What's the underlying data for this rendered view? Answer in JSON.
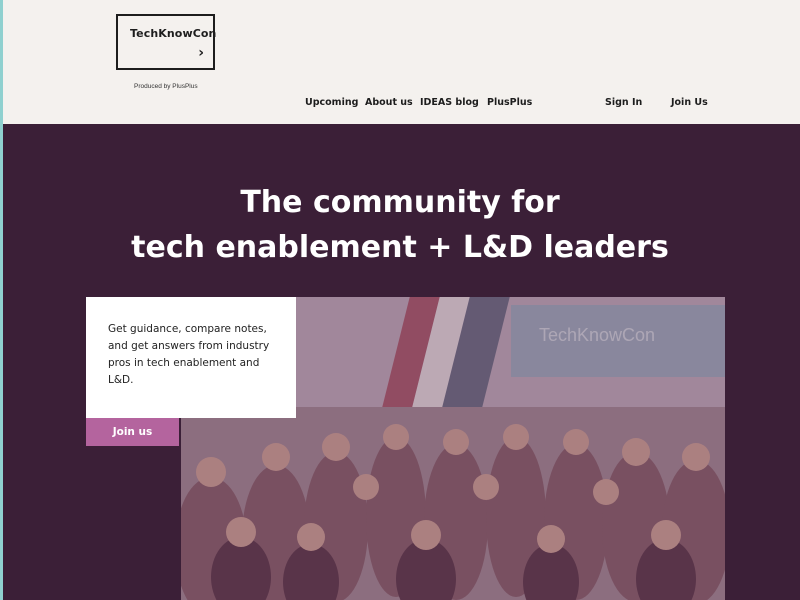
{
  "brand": {
    "name": "TechKnowCon",
    "arrow": "›",
    "produced_by": "Produced by PlusPlus"
  },
  "nav": {
    "items": [
      {
        "label": "Upcoming"
      },
      {
        "label": "About us"
      },
      {
        "label": "IDEAS blog"
      },
      {
        "label": "PlusPlus"
      }
    ],
    "sign_in": "Sign In",
    "join": "Join Us"
  },
  "hero": {
    "title_line1": "The community for",
    "title_line2": "tech enablement + L&D leaders",
    "card_text": "Get guidance, compare notes, and get answers from industry pros in tech enablement and L&D.",
    "cta": "Join us",
    "photo_screen_text": "TechKnowCon"
  },
  "colors": {
    "header_bg": "#f4f1ee",
    "hero_bg": "#3b1f37",
    "accent": "#b4649e",
    "edge": "#8fd0cf"
  }
}
